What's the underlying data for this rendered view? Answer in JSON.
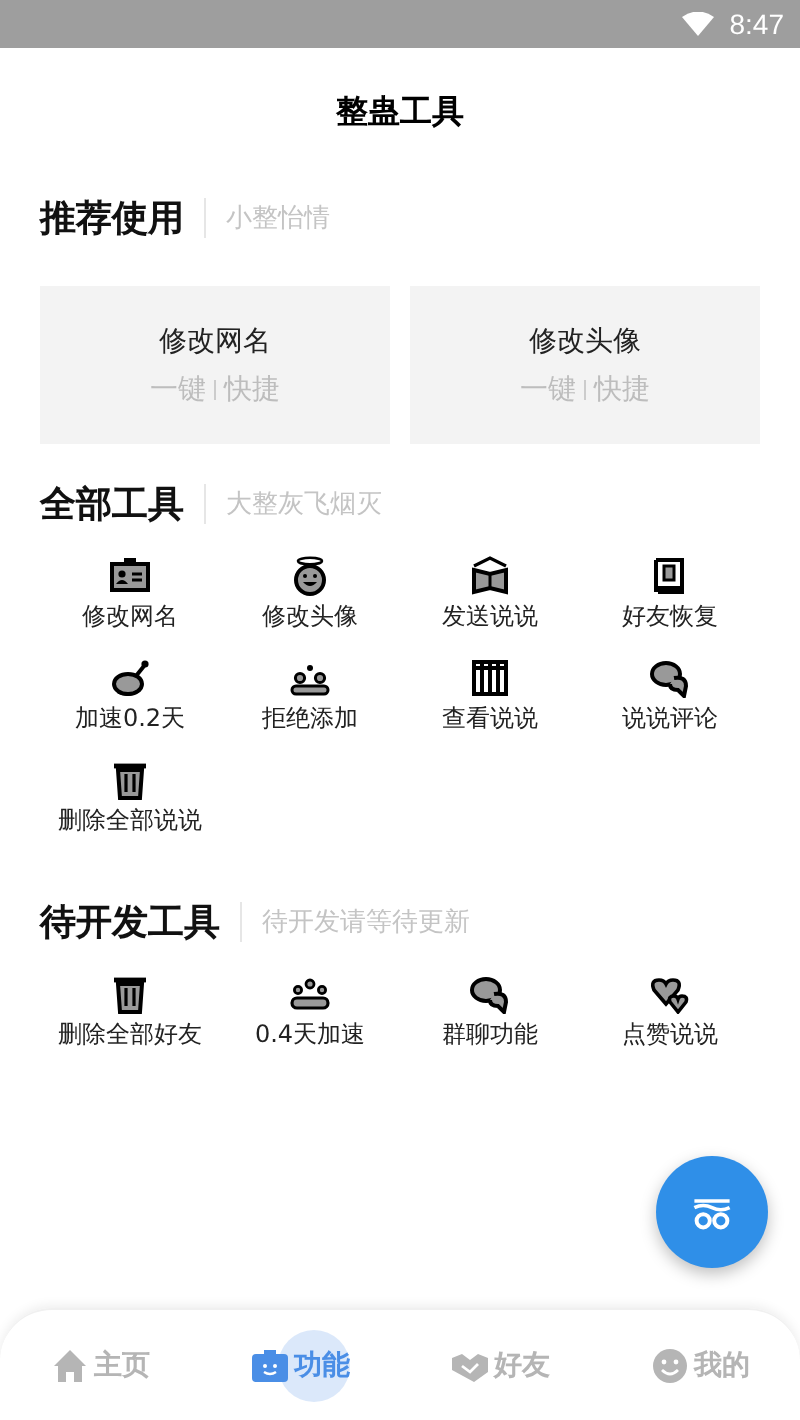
{
  "status_bar": {
    "time": "8:47"
  },
  "title": "整蛊工具",
  "sections": [
    {
      "title": "推荐使用",
      "subtitle": "小整怡情",
      "kind": "cards",
      "items": [
        {
          "label": "修改网名",
          "sub1": "一键",
          "sub2": "快捷"
        },
        {
          "label": "修改头像",
          "sub1": "一键",
          "sub2": "快捷"
        }
      ]
    },
    {
      "title": "全部工具",
      "subtitle": "大整灰飞烟灭",
      "kind": "grid",
      "items": [
        {
          "label": "修改网名"
        },
        {
          "label": "修改头像"
        },
        {
          "label": "发送说说"
        },
        {
          "label": "好友恢复"
        },
        {
          "label": "加速0.2天"
        },
        {
          "label": "拒绝添加"
        },
        {
          "label": "查看说说"
        },
        {
          "label": "说说评论"
        },
        {
          "label": "删除全部说说"
        }
      ]
    },
    {
      "title": "待开发工具",
      "subtitle": "待开发请等待更新",
      "kind": "grid",
      "items": [
        {
          "label": "删除全部好友"
        },
        {
          "label": "0.4天加速"
        },
        {
          "label": "群聊功能"
        },
        {
          "label": "点赞说说"
        }
      ]
    }
  ],
  "nav": [
    {
      "label": "主页",
      "selected": false
    },
    {
      "label": "功能",
      "selected": true
    },
    {
      "label": "好友",
      "selected": false
    },
    {
      "label": "我的",
      "selected": false
    }
  ]
}
